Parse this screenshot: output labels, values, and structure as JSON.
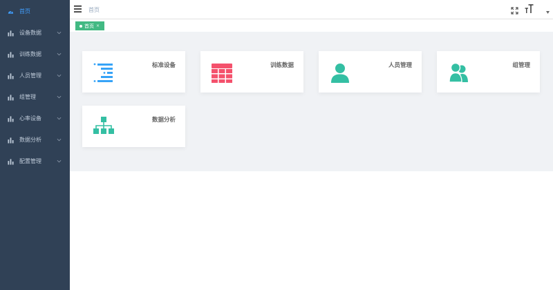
{
  "sidebar": {
    "items": [
      {
        "label": "首页",
        "active": true,
        "has_children": false
      },
      {
        "label": "设备数据",
        "active": false,
        "has_children": true
      },
      {
        "label": "训练数据",
        "active": false,
        "has_children": true
      },
      {
        "label": "人员管理",
        "active": false,
        "has_children": true
      },
      {
        "label": "组管理",
        "active": false,
        "has_children": true
      },
      {
        "label": "心率设备",
        "active": false,
        "has_children": true
      },
      {
        "label": "数据分析",
        "active": false,
        "has_children": true
      },
      {
        "label": "配置管理",
        "active": false,
        "has_children": true
      }
    ],
    "colors": {
      "background": "#304156",
      "text": "#bfcbd9",
      "active": "#409eff"
    }
  },
  "header": {
    "breadcrumb": "首页",
    "icons": [
      "hamburger-icon",
      "fullscreen-icon",
      "text-size-icon",
      "caret-down-icon"
    ]
  },
  "tags": {
    "items": [
      {
        "label": "首页",
        "close": "×",
        "active": true
      }
    ],
    "colors": {
      "active": "#42b983"
    }
  },
  "panels": {
    "items": [
      {
        "title": "标准设备",
        "icon": "list-icon",
        "color": "#36a3f7"
      },
      {
        "title": "训练数据",
        "icon": "grid-table-icon",
        "color": "#f4516c"
      },
      {
        "title": "人员管理",
        "icon": "user-icon",
        "color": "#34bfa3"
      },
      {
        "title": "组管理",
        "icon": "users-group-icon",
        "color": "#34bfa3"
      },
      {
        "title": "数据分析",
        "icon": "tree-structure-icon",
        "color": "#34bfa3"
      }
    ]
  }
}
